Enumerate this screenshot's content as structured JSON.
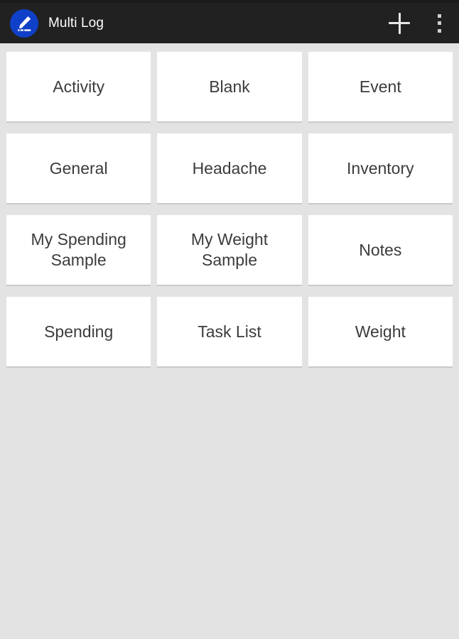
{
  "app": {
    "title": "Multi Log",
    "icon": "pencil-note-icon",
    "brand_color": "#1140c8",
    "appbar_color": "#212121",
    "background_color": "#e3e3e3",
    "tile_color": "#ffffff",
    "tile_text_color": "#3c3c3c"
  },
  "appbar": {
    "add_label": "+",
    "add_icon": "plus-icon",
    "overflow_icon": "more-vertical-icon"
  },
  "grid": {
    "columns": 3,
    "tiles": [
      {
        "label": "Activity"
      },
      {
        "label": "Blank"
      },
      {
        "label": "Event"
      },
      {
        "label": "General"
      },
      {
        "label": "Headache"
      },
      {
        "label": "Inventory"
      },
      {
        "label": "My Spending Sample"
      },
      {
        "label": "My Weight Sample"
      },
      {
        "label": "Notes"
      },
      {
        "label": "Spending"
      },
      {
        "label": "Task List"
      },
      {
        "label": "Weight"
      }
    ]
  }
}
